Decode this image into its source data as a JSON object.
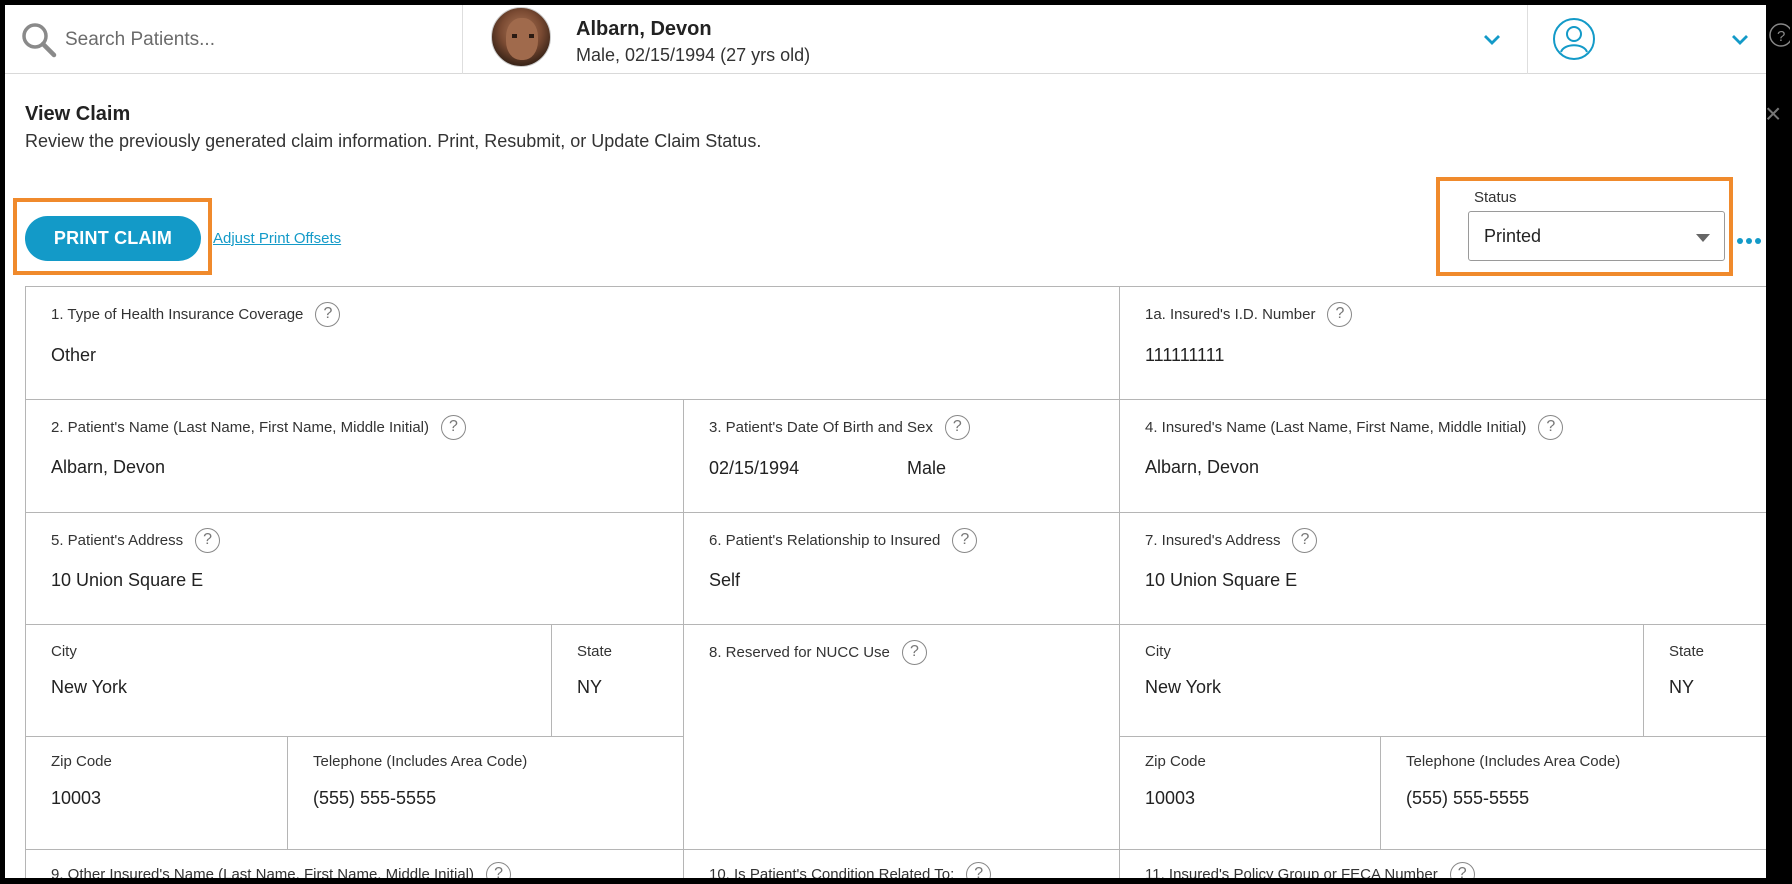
{
  "search": {
    "placeholder": "Search Patients..."
  },
  "patient": {
    "name": "Albarn, Devon",
    "meta": "Male, 02/15/1994 (27 yrs old)"
  },
  "page": {
    "title": "View Claim",
    "subtitle": "Review the previously generated claim information. Print, Resubmit, or Update Claim Status."
  },
  "actions": {
    "print_label": "PRINT CLAIM",
    "offsets_link": "Adjust Print Offsets"
  },
  "status": {
    "label": "Status",
    "value": "Printed"
  },
  "colors": {
    "accent": "#139ac8",
    "highlight": "#f08a2c",
    "border": "#b5b5b5"
  },
  "form": {
    "f1": {
      "label": "1. Type of Health Insurance Coverage",
      "value": "Other"
    },
    "f1a": {
      "label": "1a. Insured's I.D. Number",
      "value": "111111111"
    },
    "f2": {
      "label": "2. Patient's Name (Last Name, First Name, Middle Initial)",
      "value": "Albarn, Devon"
    },
    "f3": {
      "label": "3. Patient's Date Of Birth and Sex",
      "dob": "02/15/1994",
      "sex": "Male"
    },
    "f4": {
      "label": "4. Insured's Name (Last Name, First Name, Middle Initial)",
      "value": "Albarn, Devon"
    },
    "f5": {
      "label": "5. Patient's Address",
      "value": "10 Union Square E"
    },
    "f6": {
      "label": "6. Patient's Relationship to Insured",
      "value": "Self"
    },
    "f7": {
      "label": "7. Insured's Address",
      "value": "10 Union Square E"
    },
    "city5": {
      "label": "City",
      "value": "New York"
    },
    "state5": {
      "label": "State",
      "value": "NY"
    },
    "f8": {
      "label": "8. Reserved for NUCC Use"
    },
    "city7": {
      "label": "City",
      "value": "New York"
    },
    "state7": {
      "label": "State",
      "value": "NY"
    },
    "zip5": {
      "label": "Zip Code",
      "value": "10003"
    },
    "tel5": {
      "label": "Telephone (Includes Area Code)",
      "value": "(555) 555-5555"
    },
    "zip7": {
      "label": "Zip Code",
      "value": "10003"
    },
    "tel7": {
      "label": "Telephone (Includes Area Code)",
      "value": "(555) 555-5555"
    },
    "f9": {
      "label": "9. Other Insured's Name (Last Name, First Name, Middle Initial)"
    },
    "f10": {
      "label": "10. Is Patient's Condition Related To:"
    },
    "f11": {
      "label": "11. Insured's Policy Group or FECA Number"
    }
  },
  "icons": {
    "search": "search-icon",
    "user": "user-icon",
    "help": "help-icon",
    "close": "close-icon",
    "more": "more-dots-icon",
    "chevron": "chevron-down-icon"
  }
}
